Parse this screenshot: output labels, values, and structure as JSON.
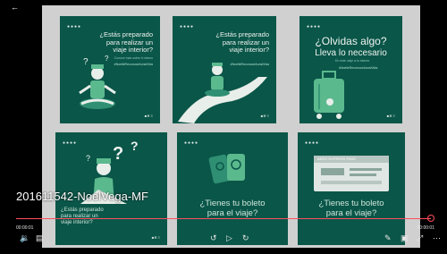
{
  "player": {
    "file_name": "201611542-NoelVega-MF",
    "time_current": "00:00:01",
    "time_total": "00:00:01",
    "progress": 1.0
  },
  "slides": {
    "dots": "●●●●",
    "logo": "■✕ ≡",
    "tile1": {
      "line1": "¿Estás preparado",
      "line2": "para realizar un",
      "line3": "viaje interior?",
      "subtitle": "Conoce más sobre ti mismo",
      "hashtag": "#NoelleReconoceAunsiVida"
    },
    "tile2": {
      "line1": "¿Estás preparado",
      "line2": "para realizar un",
      "line3": "viaje interior?",
      "hashtag": "#NoelleReconoceAunsiVida"
    },
    "tile3": {
      "line1": "¿Olvidas algo?",
      "line2": "Lleva lo necesario",
      "subtitle": "En este viaje a tu interior",
      "hashtag": "#NoelleReconoceAunsiVida"
    },
    "tile4": {
      "line1": "¿Estás preparado",
      "line2": "para realizar un",
      "line3": "viaje interior?"
    },
    "tile5": {
      "line1": "¿Tienes tu boleto",
      "line2": "para el viaje?"
    },
    "tile6": {
      "pass": "AERO EXPRESS PASS",
      "line1": "¿Tienes tu boleto",
      "line2": "para el viaje?"
    }
  },
  "controls": {
    "back": "←",
    "volume": "🔉",
    "subtitles": "▤",
    "prev": "↺",
    "play": "▷",
    "next": "↻",
    "pen": "✎",
    "miniplayer": "▣",
    "fullscreen": "⤢",
    "more": "⋯"
  },
  "colors": {
    "accent": "#ff4d5e",
    "tile": "#0a5648",
    "slide_bg": "#cfd0cf"
  }
}
